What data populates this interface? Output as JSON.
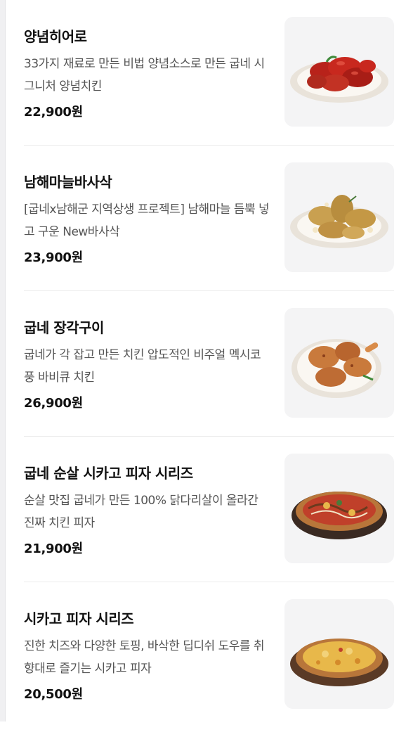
{
  "menu": {
    "items": [
      {
        "name": "양념히어로",
        "desc": "33가지 재료로 만든 비법 양념소스로 만든 굽네 시그니처 양념치킨",
        "price": "22,900원",
        "image": "seasoned-chicken-image"
      },
      {
        "name": "남해마늘바사삭",
        "desc": "[굽네x남해군 지역상생 프로젝트] 남해마늘 듬뿍 넣고 구운 New바사삭",
        "price": "23,900원",
        "image": "garlic-chicken-image"
      },
      {
        "name": "굽네 장각구이",
        "desc": "굽네가 각 잡고 만든 치킨 압도적인 비주얼 멕시코풍 바비큐 치킨",
        "price": "26,900원",
        "image": "roasted-leg-chicken-image"
      },
      {
        "name": "굽네 순살 시카고 피자 시리즈",
        "desc": "순살 맛집 굽네가 만든 100% 닭다리살이 올라간 진짜 치킨 피자",
        "price": "21,900원",
        "image": "chicken-pizza-image"
      },
      {
        "name": "시카고 피자 시리즈",
        "desc": "진한 치즈와 다양한 토핑, 바삭한 딥디쉬 도우를 취향대로 즐기는 시카고 피자",
        "price": "20,500원",
        "image": "chicago-pizza-image"
      }
    ]
  },
  "colors": {
    "sauce_red": "#c8281e",
    "garlic_gold": "#c9a050",
    "roast_orange": "#c97a3c",
    "pizza_crust": "#b8763a",
    "cheese": "#e8b84a"
  }
}
